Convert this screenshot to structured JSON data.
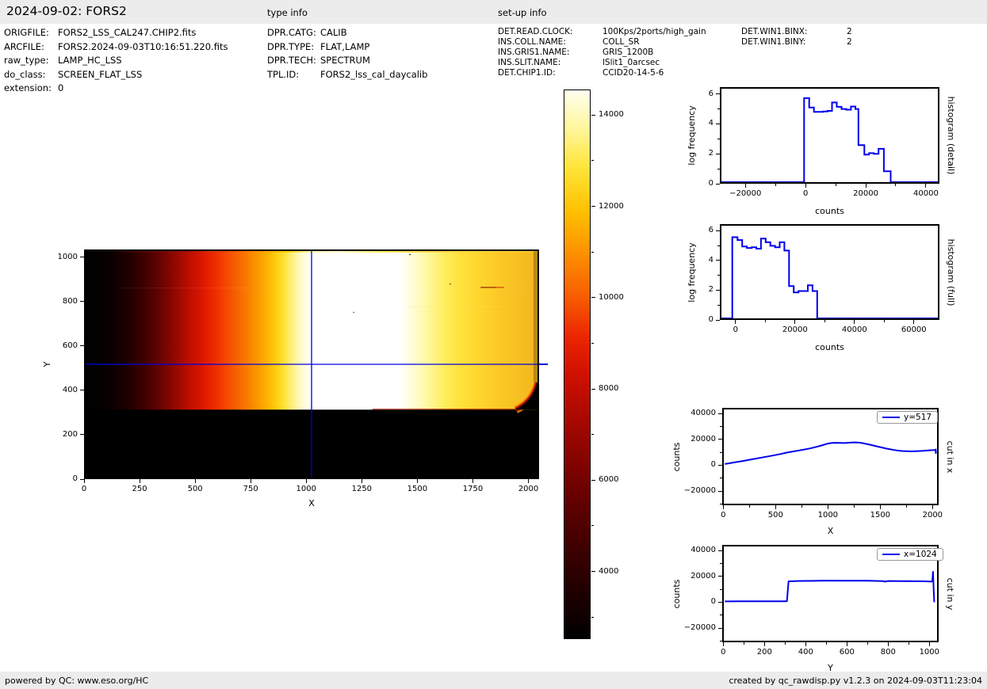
{
  "header": {
    "title": "2024-09-02: FORS2",
    "type_info_label": "type info",
    "setup_info_label": "set-up info"
  },
  "file_info": {
    "rows": [
      {
        "label": "ORIGFILE:",
        "value": "FORS2_LSS_CAL247.CHIP2.fits"
      },
      {
        "label": "ARCFILE:",
        "value": "FORS2.2024-09-03T10:16:51.220.fits"
      },
      {
        "label": "raw_type:",
        "value": "LAMP_HC_LSS"
      },
      {
        "label": "do_class:",
        "value": "SCREEN_FLAT_LSS"
      },
      {
        "label": "extension:",
        "value": "0"
      }
    ]
  },
  "type_info": {
    "rows": [
      {
        "label": "DPR.CATG:",
        "value": "CALIB"
      },
      {
        "label": "DPR.TYPE:",
        "value": "FLAT,LAMP"
      },
      {
        "label": "DPR.TECH:",
        "value": "SPECTRUM"
      },
      {
        "label": "TPL.ID:",
        "value": "FORS2_lss_cal_daycalib"
      }
    ]
  },
  "setup_info": {
    "col1": [
      {
        "label": "DET.READ.CLOCK:",
        "value": "100Kps/2ports/high_gain"
      },
      {
        "label": "INS.COLL.NAME:",
        "value": "COLL_SR"
      },
      {
        "label": "INS.GRIS1.NAME:",
        "value": "GRIS_1200B"
      },
      {
        "label": "INS.SLIT.NAME:",
        "value": "lSlit1_0arcsec"
      },
      {
        "label": "DET.CHIP1.ID:",
        "value": "CCID20-14-5-6"
      }
    ],
    "col2": [
      {
        "label": "DET.WIN1.BINX:",
        "value": "2"
      },
      {
        "label": "DET.WIN1.BINY:",
        "value": "2"
      }
    ]
  },
  "footer": {
    "left": "powered by QC: www.eso.org/HC",
    "right": "created by qc_rawdisp.py v1.2.3 on 2024-09-03T11:23:04"
  },
  "chart_data": [
    {
      "id": "main",
      "type": "heatmap",
      "title": "",
      "xlabel": "X",
      "ylabel": "Y",
      "xlim": [
        0,
        2048
      ],
      "ylim": [
        0,
        1034
      ],
      "xticks": [
        0,
        250,
        500,
        750,
        1000,
        1250,
        1500,
        1750,
        2000
      ],
      "yticks": [
        0,
        200,
        400,
        600,
        800,
        1000
      ],
      "crosshair": {
        "x": 1024,
        "y": 517,
        "color": "#0000dd"
      },
      "band_y_range": [
        310,
        1034
      ],
      "counts_range": [
        2500,
        14560
      ],
      "colormap": "hot",
      "gradient": [
        [
          0.0,
          "#000000"
        ],
        [
          0.055,
          "#0a0000"
        ],
        [
          0.09,
          "#1c0000"
        ],
        [
          0.125,
          "#3a0000"
        ],
        [
          0.16,
          "#600202"
        ],
        [
          0.195,
          "#8f0700"
        ],
        [
          0.225,
          "#b80d00"
        ],
        [
          0.255,
          "#d81500"
        ],
        [
          0.285,
          "#ee2a00"
        ],
        [
          0.315,
          "#f44d00"
        ],
        [
          0.35,
          "#f87300"
        ],
        [
          0.385,
          "#fb9c00"
        ],
        [
          0.415,
          "#fec506"
        ],
        [
          0.44,
          "#ffe338"
        ],
        [
          0.46,
          "#fff28d"
        ],
        [
          0.478,
          "#fffbcf"
        ],
        [
          0.5,
          "#ffffff"
        ],
        [
          0.695,
          "#ffffff"
        ],
        [
          0.725,
          "#fffcd4"
        ],
        [
          0.755,
          "#fff8a2"
        ],
        [
          0.79,
          "#ffef63"
        ],
        [
          0.825,
          "#ffe33e"
        ],
        [
          0.865,
          "#fed72f"
        ],
        [
          0.91,
          "#fbca26"
        ],
        [
          0.955,
          "#f7c022"
        ],
        [
          1.0,
          "#f2b61e"
        ]
      ],
      "top_stripe_gradient": [
        [
          0,
          "#200000"
        ],
        [
          0.1,
          "#6a0600"
        ],
        [
          0.18,
          "#b81200"
        ],
        [
          0.26,
          "#ee4400"
        ],
        [
          0.33,
          "#ff9000"
        ],
        [
          0.4,
          "#ffd400"
        ],
        [
          0.46,
          "#fff8a8"
        ],
        [
          0.52,
          "#fffbd0"
        ],
        [
          0.62,
          "#ffec66"
        ],
        [
          0.75,
          "#ffda48"
        ],
        [
          1,
          "#f8c22a"
        ]
      ]
    },
    {
      "id": "colorbar",
      "type": "colorbar",
      "vmin": 2500,
      "vmax": 14560,
      "ticks": [
        4000,
        6000,
        8000,
        10000,
        12000,
        14000
      ],
      "minor_dv": 1000,
      "stops": [
        [
          0,
          "#000000"
        ],
        [
          0.08,
          "#1e0000"
        ],
        [
          0.16,
          "#3c0000"
        ],
        [
          0.24,
          "#5e0000"
        ],
        [
          0.32,
          "#820300"
        ],
        [
          0.4,
          "#a80800"
        ],
        [
          0.48,
          "#cf1000"
        ],
        [
          0.55,
          "#ec2500"
        ],
        [
          0.62,
          "#f75a00"
        ],
        [
          0.7,
          "#fd8f00"
        ],
        [
          0.78,
          "#ffc100"
        ],
        [
          0.86,
          "#ffe53a"
        ],
        [
          0.93,
          "#fff69b"
        ],
        [
          1,
          "#fffef0"
        ]
      ]
    },
    {
      "id": "hist_detail",
      "type": "line",
      "xlabel": "counts",
      "ylabel": "log frequency",
      "right_label": "histogram (detail)",
      "color": "#0000ee",
      "line_width": 2,
      "xlim": [
        -28500,
        44500
      ],
      "ylim": [
        0,
        6.45
      ],
      "xticks": [
        -20000,
        0,
        20000,
        40000
      ],
      "yticks": [
        0,
        2,
        4,
        6
      ],
      "xminor": 10000,
      "yminor": 1,
      "points": [
        [
          -28500,
          0
        ],
        [
          -600,
          0
        ],
        [
          -600,
          5.8
        ],
        [
          1100,
          5.8
        ],
        [
          1100,
          5.15
        ],
        [
          2700,
          5.15
        ],
        [
          2700,
          4.85
        ],
        [
          5800,
          4.85
        ],
        [
          5800,
          4.88
        ],
        [
          7300,
          4.88
        ],
        [
          7300,
          4.92
        ],
        [
          8800,
          4.92
        ],
        [
          8800,
          5.5
        ],
        [
          10400,
          5.5
        ],
        [
          10400,
          5.2
        ],
        [
          12000,
          5.2
        ],
        [
          12000,
          5.05
        ],
        [
          13600,
          5.05
        ],
        [
          13600,
          5.0
        ],
        [
          15200,
          5.0
        ],
        [
          15200,
          5.22
        ],
        [
          16700,
          5.22
        ],
        [
          16700,
          5.05
        ],
        [
          17700,
          5.05
        ],
        [
          17700,
          2.55
        ],
        [
          19700,
          2.55
        ],
        [
          19700,
          1.9
        ],
        [
          21300,
          1.9
        ],
        [
          21300,
          2.0
        ],
        [
          22900,
          2.0
        ],
        [
          22900,
          1.95
        ],
        [
          24500,
          1.95
        ],
        [
          24500,
          2.3
        ],
        [
          26300,
          2.3
        ],
        [
          26300,
          0.75
        ],
        [
          28600,
          0.75
        ],
        [
          28600,
          0
        ],
        [
          44500,
          0
        ]
      ]
    },
    {
      "id": "hist_full",
      "type": "line",
      "xlabel": "counts",
      "ylabel": "log frequency",
      "right_label": "histogram (full)",
      "color": "#0000ee",
      "line_width": 2,
      "xlim": [
        -5300,
        68600
      ],
      "ylim": [
        0,
        6.45
      ],
      "xticks": [
        0,
        20000,
        40000,
        60000
      ],
      "yticks": [
        0,
        2,
        4,
        6
      ],
      "xminor": 10000,
      "yminor": 1,
      "points": [
        [
          -5300,
          0
        ],
        [
          -1600,
          0
        ],
        [
          -1600,
          5.65
        ],
        [
          200,
          5.65
        ],
        [
          200,
          5.45
        ],
        [
          1800,
          5.45
        ],
        [
          1800,
          5.0
        ],
        [
          3400,
          5.0
        ],
        [
          3400,
          4.9
        ],
        [
          5000,
          4.9
        ],
        [
          5000,
          4.95
        ],
        [
          6600,
          4.95
        ],
        [
          6600,
          4.85
        ],
        [
          8200,
          4.85
        ],
        [
          8200,
          5.55
        ],
        [
          9800,
          5.55
        ],
        [
          9800,
          5.3
        ],
        [
          11400,
          5.3
        ],
        [
          11400,
          5.05
        ],
        [
          13000,
          5.05
        ],
        [
          13000,
          4.95
        ],
        [
          14600,
          4.95
        ],
        [
          14600,
          5.3
        ],
        [
          16200,
          5.3
        ],
        [
          16200,
          4.72
        ],
        [
          17800,
          4.72
        ],
        [
          17800,
          2.25
        ],
        [
          19400,
          2.25
        ],
        [
          19400,
          1.8
        ],
        [
          21000,
          1.8
        ],
        [
          21000,
          1.9
        ],
        [
          24200,
          1.9
        ],
        [
          24200,
          2.3
        ],
        [
          25800,
          2.3
        ],
        [
          25800,
          1.9
        ],
        [
          27400,
          1.9
        ],
        [
          27400,
          0
        ],
        [
          68600,
          0
        ]
      ]
    },
    {
      "id": "cut_x",
      "type": "line",
      "xlabel": "X",
      "ylabel": "counts",
      "right_label": "cut in x",
      "legend": "y=517",
      "color": "#0000ee",
      "line_width": 2,
      "xlim": [
        -10,
        2058
      ],
      "ylim": [
        -31000,
        44300
      ],
      "xticks": [
        0,
        500,
        1000,
        1500,
        2000
      ],
      "yticks": [
        -20000,
        0,
        20000,
        40000
      ],
      "xminor": 250,
      "yminor": 10000,
      "points": [
        [
          0,
          700
        ],
        [
          60,
          1500
        ],
        [
          120,
          2400
        ],
        [
          180,
          3200
        ],
        [
          240,
          4100
        ],
        [
          300,
          5000
        ],
        [
          360,
          5900
        ],
        [
          420,
          6800
        ],
        [
          480,
          7700
        ],
        [
          540,
          8700
        ],
        [
          600,
          9800
        ],
        [
          660,
          10700
        ],
        [
          720,
          11500
        ],
        [
          780,
          12400
        ],
        [
          840,
          13400
        ],
        [
          900,
          14700
        ],
        [
          950,
          15800
        ],
        [
          1000,
          17000
        ],
        [
          1040,
          17550
        ],
        [
          1080,
          17650
        ],
        [
          1120,
          17550
        ],
        [
          1160,
          17500
        ],
        [
          1200,
          17700
        ],
        [
          1250,
          17950
        ],
        [
          1290,
          17850
        ],
        [
          1330,
          17450
        ],
        [
          1370,
          16800
        ],
        [
          1420,
          15900
        ],
        [
          1470,
          14900
        ],
        [
          1520,
          13900
        ],
        [
          1570,
          13000
        ],
        [
          1620,
          12200
        ],
        [
          1670,
          11500
        ],
        [
          1720,
          11100
        ],
        [
          1770,
          10900
        ],
        [
          1820,
          10850
        ],
        [
          1870,
          11000
        ],
        [
          1920,
          11200
        ],
        [
          1970,
          11500
        ],
        [
          2010,
          11750
        ],
        [
          2035,
          11900
        ],
        [
          2045,
          12200
        ],
        [
          2046,
          9000
        ],
        [
          2048,
          11200
        ]
      ]
    },
    {
      "id": "cut_y",
      "type": "line",
      "xlabel": "Y",
      "ylabel": "counts",
      "right_label": "cut in y",
      "legend": "x=1024",
      "color": "#0000ee",
      "line_width": 2,
      "xlim": [
        -5,
        1045
      ],
      "ylim": [
        -31000,
        44300
      ],
      "xticks": [
        0,
        200,
        400,
        600,
        800,
        1000
      ],
      "yticks": [
        -20000,
        0,
        20000,
        40000
      ],
      "xminor": 100,
      "yminor": 10000,
      "points": [
        [
          0,
          400
        ],
        [
          80,
          450
        ],
        [
          160,
          480
        ],
        [
          240,
          500
        ],
        [
          300,
          520
        ],
        [
          306,
          700
        ],
        [
          310,
          9000
        ],
        [
          314,
          16400
        ],
        [
          360,
          16700
        ],
        [
          420,
          16800
        ],
        [
          500,
          17000
        ],
        [
          560,
          16950
        ],
        [
          620,
          16900
        ],
        [
          700,
          16900
        ],
        [
          775,
          16650
        ],
        [
          790,
          16250
        ],
        [
          805,
          16700
        ],
        [
          860,
          16650
        ],
        [
          920,
          16550
        ],
        [
          980,
          16450
        ],
        [
          1010,
          16300
        ],
        [
          1018,
          16200
        ],
        [
          1022,
          16600
        ],
        [
          1025,
          24500
        ],
        [
          1028,
          12000
        ],
        [
          1031,
          300
        ],
        [
          1034,
          150
        ]
      ]
    }
  ]
}
